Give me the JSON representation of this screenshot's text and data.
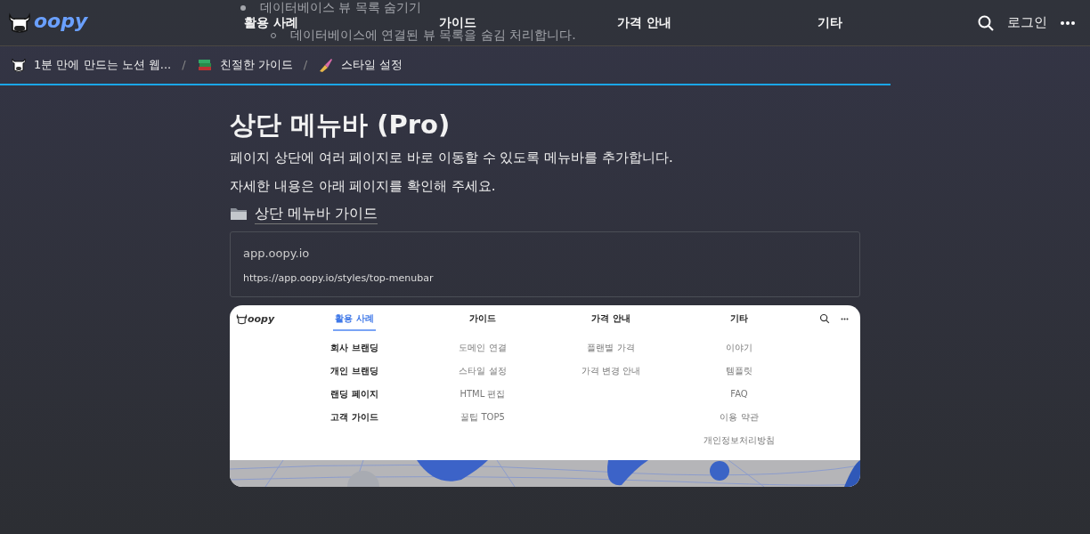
{
  "behind_header": [
    {
      "kind": "bullet",
      "text": "데이터베이스 뷰 목록 숨기기"
    },
    {
      "kind": "sub_bullet",
      "text": "데이터베이스에 연결된 뷰 목록을 숨김 처리합니다."
    }
  ],
  "header": {
    "logo": "oopy",
    "nav": [
      "활용 사례",
      "가이드",
      "가격 안내",
      "기타"
    ],
    "login": "로그인"
  },
  "breadcrumbs": [
    {
      "label": "1분 만에 만드는 노션 웹..."
    },
    {
      "separator": "/",
      "label": "친절한 가이드"
    },
    {
      "separator": "/",
      "label": "스타일 설정"
    }
  ],
  "scroll_progress": {
    "level": 0.817
  },
  "page": {
    "title": "상단 메뉴바 **(Pro)**",
    "paragraphs": [
      "페이지 상단에 여러 페이지로 바로 이동할 수 있도록 메뉴바를 추가합니다.",
      "자세한 내용은 아래 페이지를 확인해 주세요."
    ],
    "link": "상단 메뉴바 가이드",
    "bookmark": {
      "title": "app.oopy.io",
      "url": "https://app.oopy.io/styles/top-menubar"
    }
  },
  "preview": {
    "logo": "oopy",
    "columns": [
      {
        "label": "활용 사례",
        "selected": true,
        "items": [
          {
            "label": "회사 브랜딩",
            "dim": false
          },
          {
            "label": "개인 브랜딩",
            "dim": false
          },
          {
            "label": "랜딩 페이지",
            "dim": false
          },
          {
            "label": "고객 가이드",
            "dim": false
          }
        ]
      },
      {
        "label": "가이드",
        "selected": false,
        "items": [
          {
            "label": "도메인 연결",
            "dim": true
          },
          {
            "label": "스타일 설정",
            "dim": true
          },
          {
            "label": "HTML 편집",
            "dim": true
          },
          {
            "label": "꿀팁 TOP5",
            "dim": true
          }
        ]
      },
      {
        "label": "가격 안내",
        "selected": false,
        "items": [
          {
            "label": "플랜별 가격",
            "dim": true
          },
          {
            "label": "가격 변경 안내",
            "dim": true
          }
        ]
      },
      {
        "label": "기타",
        "selected": false,
        "items": [
          {
            "label": "이야기",
            "dim": true
          },
          {
            "label": "템플릿",
            "dim": true
          },
          {
            "label": "FAQ",
            "dim": true
          },
          {
            "label": "이용 약관",
            "dim": true
          },
          {
            "label": "개인정보처리방침",
            "dim": true
          }
        ]
      }
    ]
  }
}
